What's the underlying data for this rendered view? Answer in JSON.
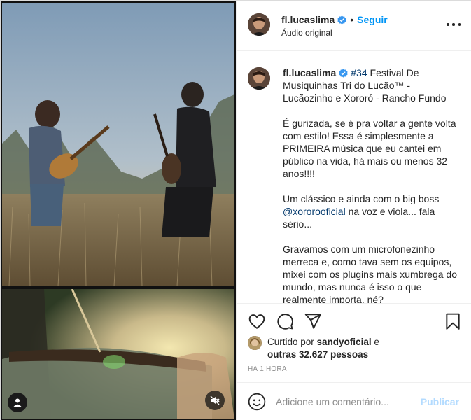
{
  "post": {
    "author": "fl.lucaslima",
    "follow_label": "Seguir",
    "separator": "•",
    "audio_label": "Áudio original"
  },
  "caption": {
    "author": "fl.lucaslima",
    "hashtag": "#34",
    "title_text": " Festival De Musiquinhas Tri do Lucão™ - Lucãozinho e Xororó - Rancho Fundo",
    "para1": "É gurizada, se é pra voltar a gente volta com estilo! Essa é simplesmente a PRIMEIRA música que eu cantei em público na vida, há mais ou menos 32 anos!!!!",
    "para2_before": "Um clássico e ainda com o big boss ",
    "mention": "@xororooficial",
    "para2_after": " na voz e viola... fala sério...",
    "para3": "Gravamos com um microfonezinho merreca e, como tava sem os equipos, mixei com os plugins mais xumbrega do mundo, mas nunca é isso o que realmente importa, né?"
  },
  "likes": {
    "prefix": "Curtido por ",
    "liked_by_user": "sandyoficial",
    "and_label": " e",
    "others": "outras 32.627 pessoas"
  },
  "timestamp": "HÁ 1 HORA",
  "comment": {
    "placeholder": "Adicione um comentário...",
    "publish_label": "Publicar"
  },
  "icons": {
    "verified": "verified-badge-icon",
    "more": "more-options-icon",
    "like": "heart-icon",
    "comment": "comment-bubble-icon",
    "share": "paper-plane-icon",
    "save": "bookmark-icon",
    "emoji": "smiley-icon",
    "user_tag": "user-tag-icon",
    "mute": "speaker-muted-icon"
  },
  "colors": {
    "link_blue": "#0095f6",
    "hashtag_blue": "#00376b",
    "muted_text": "#8e8e8e",
    "publish_disabled": "#b3dbff"
  }
}
